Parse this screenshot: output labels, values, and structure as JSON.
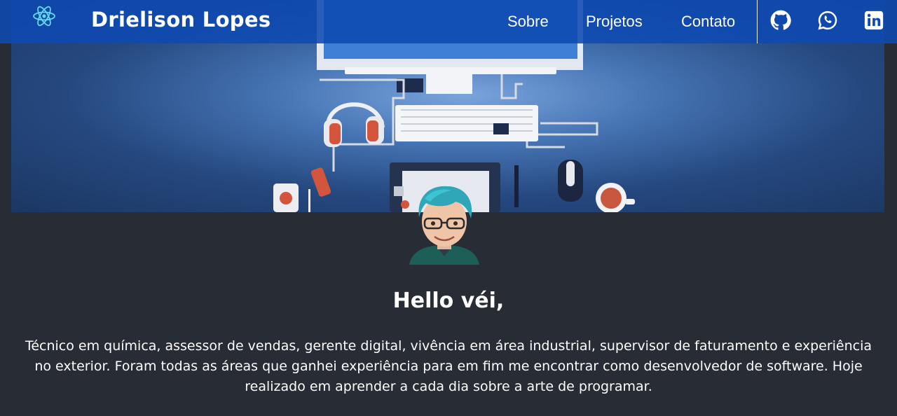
{
  "header": {
    "brand": "Drielison Lopes",
    "logo_icon": "react-atom-icon",
    "nav": {
      "sobre": "Sobre",
      "projetos": "Projetos",
      "contato": "Contato"
    },
    "social": [
      "github-icon",
      "whatsapp-icon",
      "linkedin-icon"
    ]
  },
  "hero": {
    "banner_image": "desk-workspace-illustration",
    "avatar_image": "avatar-illustration"
  },
  "content": {
    "greeting": "Hello véi,",
    "bio": "Técnico em química, assessor de vendas, gerente digital, vivência em área industrial, supervisor de faturamento e experiência no exterior. Foram todas as áreas que ganhei experiência para em fim me encontrar como desenvolvedor de software. Hoje realizado em aprender a cada dia sobre a arte de programar."
  },
  "colors": {
    "page_background": "#282c34",
    "navbar": "#0e4ab2",
    "react_accent": "#61dafb"
  }
}
